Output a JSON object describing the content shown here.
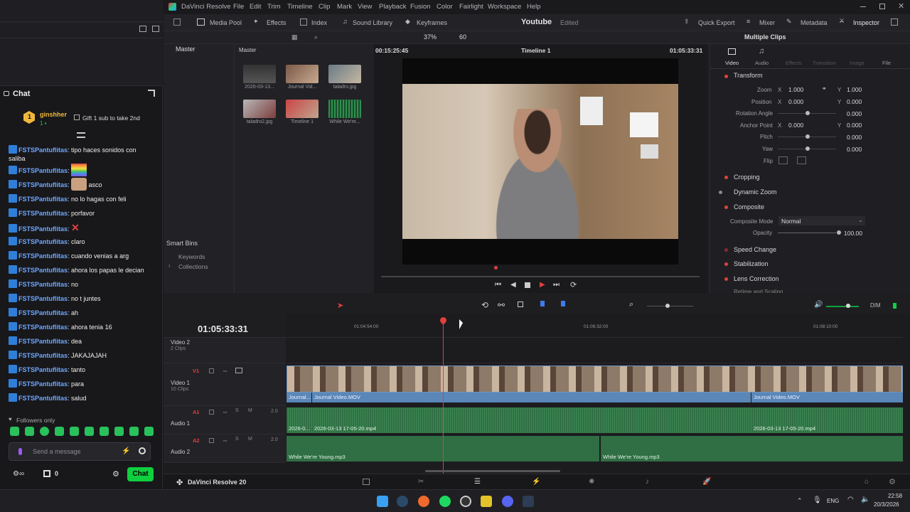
{
  "chat": {
    "title": "Chat",
    "sub_user": "ginshher",
    "sub_count": "1",
    "sub_gift_text": "Gift 1 sub to take 2nd",
    "messages": [
      {
        "user": "FSTSPantuflitas",
        "text": "tipo haces sonidos con"
      },
      {
        "user": "",
        "text": "saliba"
      },
      {
        "user": "FSTSPantuflitas",
        "text": ""
      },
      {
        "user": "FSTSPantuflitas",
        "text": "asco"
      },
      {
        "user": "FSTSPantuflitas",
        "text": "no lo hagas con feli"
      },
      {
        "user": "FSTSPantuflitas",
        "text": "porfavor"
      },
      {
        "user": "FSTSPantuflitas",
        "text": ""
      },
      {
        "user": "FSTSPantuflitas",
        "text": "claro"
      },
      {
        "user": "FSTSPantuflitas",
        "text": "cuando venias a arg"
      },
      {
        "user": "FSTSPantuflitas",
        "text": "ahora los papas le decian"
      },
      {
        "user": "FSTSPantuflitas",
        "text": "no"
      },
      {
        "user": "FSTSPantuflitas",
        "text": "no t juntes"
      },
      {
        "user": "FSTSPantuflitas",
        "text": "ah"
      },
      {
        "user": "FSTSPantuflitas",
        "text": "ahora tenia 16"
      },
      {
        "user": "FSTSPantuflitas",
        "text": "dea"
      },
      {
        "user": "FSTSPantuflitas",
        "text": "JAKAJAJAH"
      },
      {
        "user": "FSTSPantuflitas",
        "text": "tanto"
      },
      {
        "user": "FSTSPantuflitas",
        "text": "para"
      },
      {
        "user": "FSTSPantuflitas",
        "text": "salud"
      }
    ],
    "followers_only": "Followers only",
    "input_placeholder": "Send a message",
    "points": "0",
    "send_button": "Chat"
  },
  "resolve": {
    "app_title": "DaVinci Resolve",
    "menu": [
      "File",
      "Edit",
      "Trim",
      "Timeline",
      "Clip",
      "Mark",
      "View",
      "Playback",
      "Fusion",
      "Color",
      "Fairlight",
      "Workspace",
      "Help"
    ],
    "toolbar": {
      "media_pool": "Media Pool",
      "effects": "Effects",
      "index": "Index",
      "sound_library": "Sound Library",
      "keyframes": "Keyframes",
      "project_name": "Youtube",
      "project_status": "Edited",
      "quick_export": "Quick Export",
      "mixer": "Mixer",
      "metadata": "Metadata",
      "inspector": "Inspector"
    },
    "subbar": {
      "zoom": "37%",
      "fps": "60",
      "source_tc": "00:15:25:45",
      "timeline_name": "Timeline 1",
      "record_tc": "01:05:33:31",
      "selection": "Multiple Clips"
    },
    "media_pool": {
      "master_bin": "Master",
      "master_header": "Master",
      "clips": [
        {
          "name": "2026-03-13..."
        },
        {
          "name": "Journal Vid..."
        },
        {
          "name": "taladro.jpg"
        },
        {
          "name": "taladro2.jpg"
        },
        {
          "name": "Timeline 1"
        },
        {
          "name": "While We're..."
        }
      ],
      "smart_bins": "Smart Bins",
      "keywords": "Keywords",
      "collections": "Collections"
    },
    "inspector": {
      "tabs": [
        "Video",
        "Audio",
        "Effects",
        "Transition",
        "Image",
        "File"
      ],
      "transform": "Transform",
      "zoom_label": "Zoom",
      "zoom_x": "1.000",
      "zoom_y": "1.000",
      "position_label": "Position",
      "position_x": "0.000",
      "position_y": "0.000",
      "rotation_label": "Rotation Angle",
      "rotation": "0.000",
      "anchor_label": "Anchor Point",
      "anchor_x": "0.000",
      "anchor_y": "0.000",
      "pitch_label": "Pitch",
      "pitch": "0.000",
      "yaw_label": "Yaw",
      "yaw": "0.000",
      "flip_label": "Flip",
      "cropping": "Cropping",
      "dynamic_zoom": "Dynamic Zoom",
      "composite": "Composite",
      "composite_mode_label": "Composite Mode",
      "composite_mode": "Normal",
      "opacity_label": "Opacity",
      "opacity": "100.00",
      "speed_change": "Speed Change",
      "stabilization": "Stabilization",
      "lens_correction": "Lens Correction",
      "retime_scaling": "Retime and Scaling"
    },
    "timeline": {
      "timecode": "01:05:33:31",
      "ruler": [
        "01:04:54:00",
        "01:06:32:00",
        "01:08:10:00"
      ],
      "v2_name": "Video 2",
      "v2_clips": "2 Clips",
      "v1_tag": "V1",
      "v1_name": "Video 1",
      "v1_clips": "10 Clips",
      "a1_tag": "A1",
      "a1_name": "Audio 1",
      "a1_level": "2.0",
      "a2_tag": "A2",
      "a2_name": "Audio 2",
      "a2_level": "2.0",
      "dim": "DIM",
      "v1_clip_a": "Journal...",
      "v1_clip_b": "Journal Video.MOV",
      "v1_clip_c": "Journal Video.MOV",
      "a1_clip_a": "2026-0...",
      "a1_clip_b": "2026-03-13 17-05-20.mp4",
      "a1_clip_c": "2026-03-13 17-05-20.mp4",
      "a2_clip_a": "While We're Young.mp3",
      "a2_clip_b": "While We're Young.mp3"
    },
    "bottom_title": "DaVinci Resolve 20"
  },
  "taskbar": {
    "lang": "ENG",
    "time": "22:58",
    "date": "20/3/2026"
  },
  "colors": {
    "accent_red": "#e0403d",
    "clip_blue": "#5a87b8",
    "audio_green": "#2f6f43",
    "twitch_green": "#0fcf3f",
    "chat_user": "#6fa8ff"
  }
}
